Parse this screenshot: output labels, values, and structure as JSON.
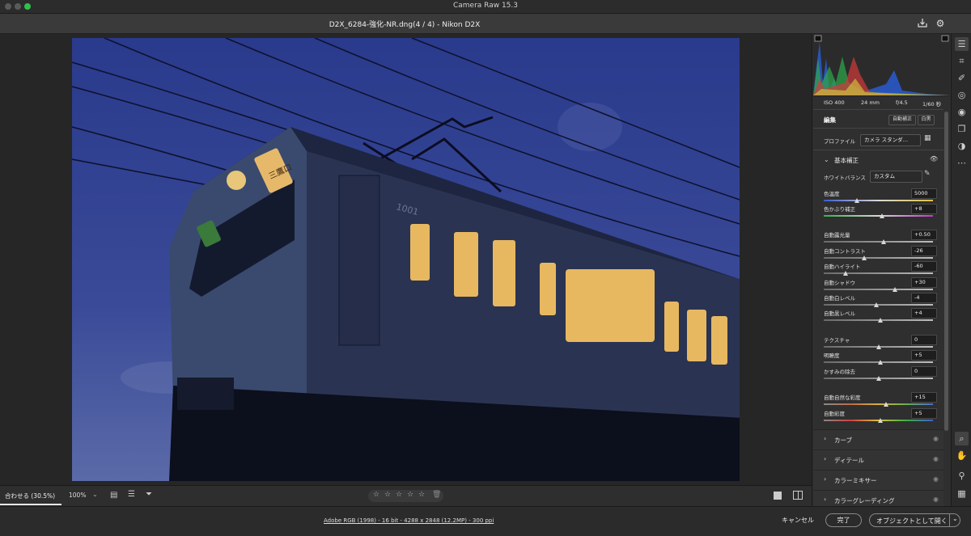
{
  "window": {
    "app_title": "Camera Raw 15.3",
    "file_title": "D2X_6284-強化-NR.dng(4 / 4)  -  Nikon D2X"
  },
  "exif": {
    "iso": "ISO 400",
    "focal": "24 mm",
    "aperture": "f/4.5",
    "shutter": "1/60 秒"
  },
  "edit_panel": {
    "title": "編集",
    "auto_button": "自動補正",
    "bw_button": "白黒",
    "profile_label": "プロファイル",
    "profile_value": "カメラ スタンダ…",
    "basic_header": "基本補正",
    "wb_label": "ホワイトバランス",
    "wb_value": "カスタム",
    "sliders": [
      {
        "label": "色温度",
        "value": "5000",
        "pos": 0.3,
        "gradient": "temp"
      },
      {
        "label": "色かぶり補正",
        "value": "+8",
        "pos": 0.53,
        "gradient": "tint"
      },
      {
        "label": "自動露光量",
        "value": "+0.50",
        "pos": 0.55,
        "gradient": "gray"
      },
      {
        "label": "自動コントラスト",
        "value": "-26",
        "pos": 0.37,
        "gradient": "gray"
      },
      {
        "label": "自動ハイライト",
        "value": "-60",
        "pos": 0.2,
        "gradient": "gray"
      },
      {
        "label": "自動シャドウ",
        "value": "+30",
        "pos": 0.65,
        "gradient": "gray"
      },
      {
        "label": "自動白レベル",
        "value": "-4",
        "pos": 0.48,
        "gradient": "gray"
      },
      {
        "label": "自動黒レベル",
        "value": "+4",
        "pos": 0.52,
        "gradient": "gray"
      },
      {
        "label": "テクスチャ",
        "value": "0",
        "pos": 0.5,
        "gradient": "gray"
      },
      {
        "label": "明瞭度",
        "value": "+5",
        "pos": 0.52,
        "gradient": "gray"
      },
      {
        "label": "かすみの除去",
        "value": "0",
        "pos": 0.5,
        "gradient": "gray"
      },
      {
        "label": "自動自然な彩度",
        "value": "+15",
        "pos": 0.57,
        "gradient": "vib"
      },
      {
        "label": "自動彩度",
        "value": "+5",
        "pos": 0.52,
        "gradient": "sat"
      }
    ],
    "sections": [
      "カーブ",
      "ディテール",
      "カラーミキサー",
      "カラーグレーディング"
    ]
  },
  "viewbar": {
    "fit_label": "合わせる (30.5%)",
    "zoom_label": "100%",
    "stars": [
      "☆",
      "☆",
      "☆",
      "☆",
      "☆"
    ]
  },
  "status": {
    "info_link": "Adobe RGB (1998) - 16 bit - 4288 x 2848 (12.2MP) - 300 ppi",
    "cancel": "キャンセル",
    "done": "完了",
    "open": "オブジェクトとして開く"
  },
  "photo_text": {
    "destination": "三鷹口",
    "number": "1001"
  },
  "colors": {
    "accent": "#3d8ee8",
    "panel": "#2f2f2f",
    "sky": "#2d3a82"
  }
}
